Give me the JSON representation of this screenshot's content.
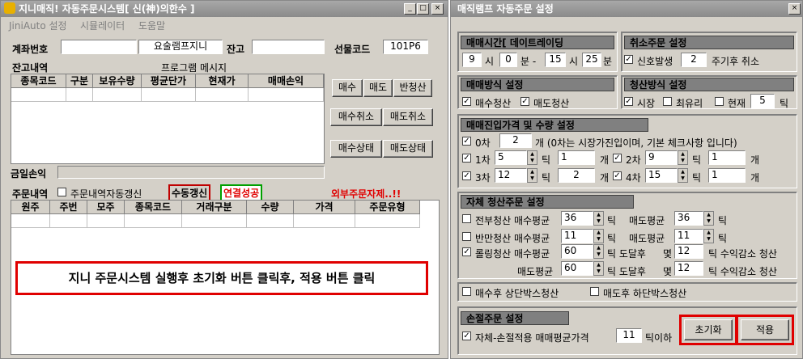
{
  "left": {
    "title": "지니매직! 자동주문시스템[ 신(神)의한수 ]",
    "menu": [
      "JiniAuto 설정",
      "시뮬레이터",
      "도움말"
    ],
    "account_label": "계좌번호",
    "account_value": "",
    "account_name": "요술램프지니",
    "balance_label": "잔고",
    "balance_value": "",
    "futures_label": "선물코드",
    "futures_value": "101P6",
    "holdings_label": "잔고내역",
    "message_label": "프로그램 메시지",
    "holdings_cols": [
      "종목코드",
      "구분",
      "보유수량",
      "평균단가",
      "현재가",
      "매매손익"
    ],
    "buttons": [
      "매수",
      "매도",
      "반청산",
      "매수취소",
      "매도취소",
      "매수상태",
      "매도상태"
    ],
    "pnl_label": "금일손익",
    "orders_label": "주문내역",
    "auto_refresh_label": "주문내역자동갱신",
    "manual_refresh": "수동갱신",
    "conn_status": "연결성공",
    "external_ban": "외부주문자제..!!",
    "order_cols": [
      "원주",
      "주번",
      "모주",
      "종목코드",
      "거래구분",
      "수량",
      "가격",
      "주문유형"
    ],
    "notice": "지니 주문시스템 실행후 초기화 버튼 클릭후, 적용 버튼 클릭"
  },
  "right": {
    "title": "매직램프 자동주문 설정",
    "time_title": "매매시간[ 데이트레이딩",
    "time": {
      "h1": "9",
      "l1": "시",
      "m1": "0",
      "l2": "분 -",
      "h2": "15",
      "l3": "시",
      "m2": "25",
      "l4": "분"
    },
    "cancel_title": "취소주문 설정",
    "cancel": {
      "label": "신호발생",
      "value": "2",
      "suffix": "주기후 취소"
    },
    "method_title": "매매방식 설정",
    "method": [
      "매수청산",
      "매도청산"
    ],
    "clear_title": "청산방식 설정",
    "clear": [
      "시장",
      "최유리",
      "현재"
    ],
    "clear_value": "5",
    "tick": "틱",
    "entry_title": "매매진입가격 및 수량 설정",
    "entry0": {
      "label": "0차",
      "value": "2",
      "suffix": "개 (0차는 시장가진입이며, 기본 체크사항 입니다)"
    },
    "entries": [
      {
        "label": "1차",
        "tick": "5",
        "qty": "1"
      },
      {
        "label": "2차",
        "tick": "9",
        "qty": "1"
      },
      {
        "label": "3차",
        "tick": "12",
        "qty": "2"
      },
      {
        "label": "4차",
        "tick": "15",
        "qty": "1"
      }
    ],
    "unit_tick": "틱",
    "unit_qty": "개",
    "self_title": "자체 청산주문 설정",
    "full": {
      "label": "전부청산 매수평균",
      "buy": "36",
      "sell_label": "매도평균",
      "sell": "36"
    },
    "half": {
      "label": "반만청산 매수평균",
      "buy": "11",
      "sell_label": "매도평균",
      "sell": "11"
    },
    "rolling": {
      "label": "롤링청산 매수평균",
      "buy": "60",
      "reach": "틱 도달후",
      "count_label": "몇",
      "buy_n": "12",
      "suffix": "틱 수익감소 청산",
      "sell_label": "매도평균",
      "sell": "60",
      "sell_n": "12"
    },
    "box": [
      "매수후 상단박스청산",
      "매도후 하단박스청산"
    ],
    "stop_title": "손절주문 설정",
    "stop": {
      "label": "자체-손절적용 매매평균가격",
      "value": "11",
      "suffix": "틱이하"
    },
    "init_button": "초기화",
    "apply_button": "적용"
  }
}
